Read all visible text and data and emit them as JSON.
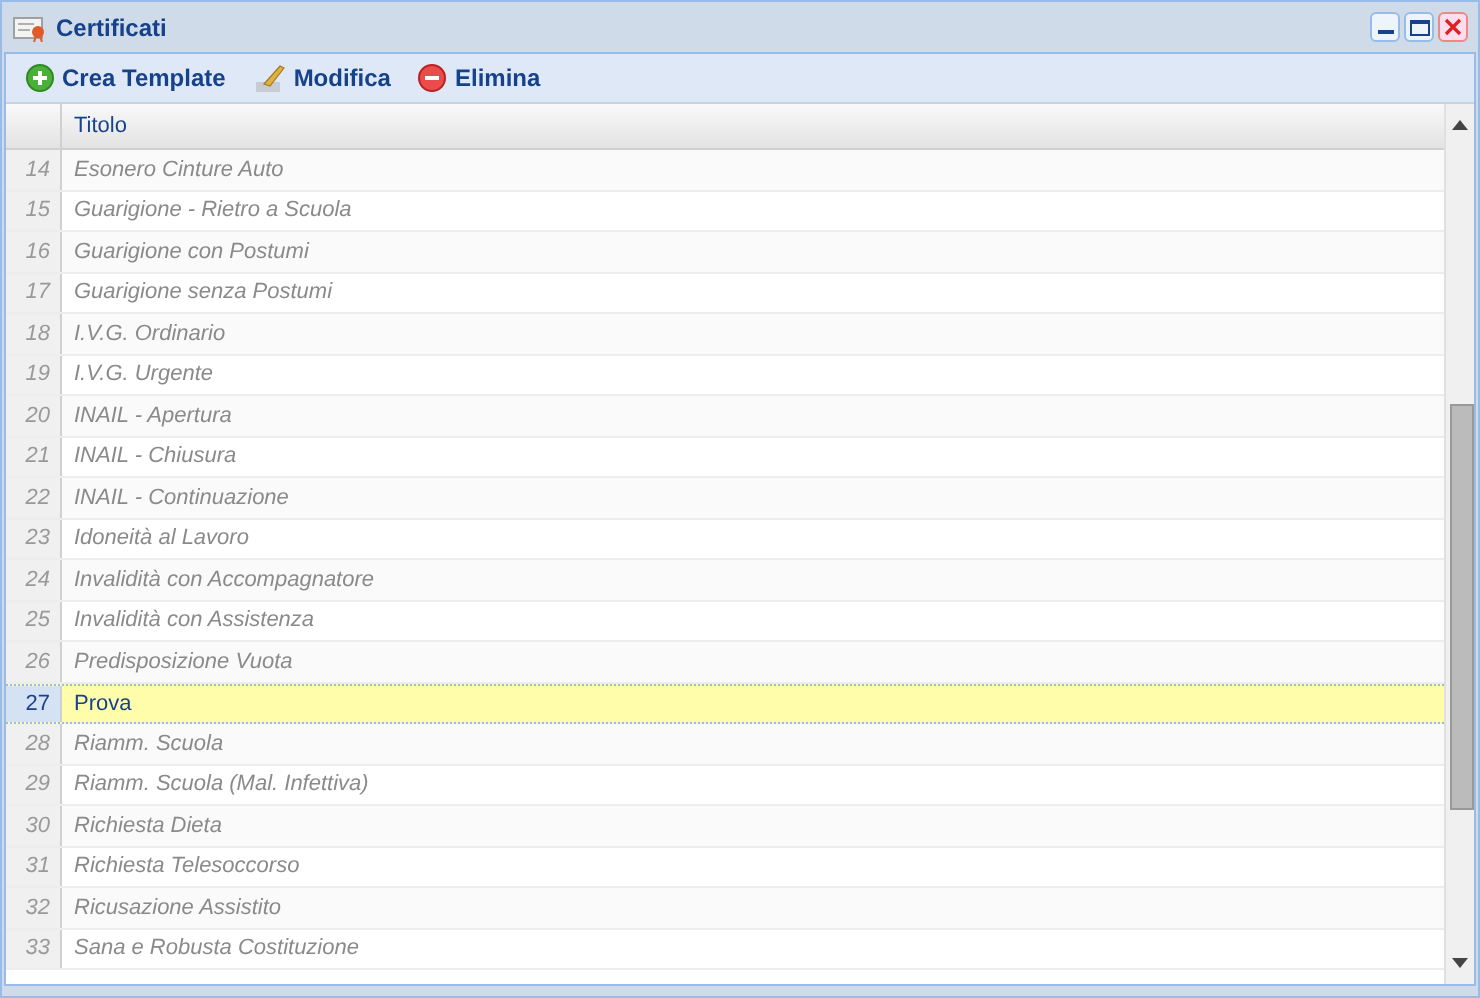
{
  "window": {
    "title": "Certificati"
  },
  "toolbar": [
    {
      "kind": "add",
      "label": "Crea Template"
    },
    {
      "kind": "edit",
      "label": "Modifica"
    },
    {
      "kind": "delete",
      "label": "Elimina"
    }
  ],
  "table": {
    "columns": [
      "Titolo"
    ],
    "rows": [
      {
        "number": "14",
        "title": "Esonero Cinture Auto",
        "selected": false
      },
      {
        "number": "15",
        "title": "Guarigione - Rietro a Scuola",
        "selected": false
      },
      {
        "number": "16",
        "title": "Guarigione con Postumi",
        "selected": false
      },
      {
        "number": "17",
        "title": "Guarigione senza Postumi",
        "selected": false
      },
      {
        "number": "18",
        "title": "I.V.G. Ordinario",
        "selected": false
      },
      {
        "number": "19",
        "title": "I.V.G. Urgente",
        "selected": false
      },
      {
        "number": "20",
        "title": "INAIL - Apertura",
        "selected": false
      },
      {
        "number": "21",
        "title": "INAIL - Chiusura",
        "selected": false
      },
      {
        "number": "22",
        "title": "INAIL - Continuazione",
        "selected": false
      },
      {
        "number": "23",
        "title": "Idoneità al Lavoro",
        "selected": false
      },
      {
        "number": "24",
        "title": "Invalidità con Accompagnatore",
        "selected": false
      },
      {
        "number": "25",
        "title": "Invalidità con Assistenza",
        "selected": false
      },
      {
        "number": "26",
        "title": "Predisposizione Vuota",
        "selected": false
      },
      {
        "number": "27",
        "title": "Prova",
        "selected": true
      },
      {
        "number": "28",
        "title": "Riamm. Scuola",
        "selected": false
      },
      {
        "number": "29",
        "title": "Riamm. Scuola (Mal. Infettiva)",
        "selected": false
      },
      {
        "number": "30",
        "title": "Richiesta Dieta",
        "selected": false
      },
      {
        "number": "31",
        "title": "Richiesta Telesoccorso",
        "selected": false
      },
      {
        "number": "32",
        "title": "Ricusazione Assistito",
        "selected": false
      },
      {
        "number": "33",
        "title": "Sana e Robusta Costituzione",
        "selected": false
      }
    ]
  }
}
